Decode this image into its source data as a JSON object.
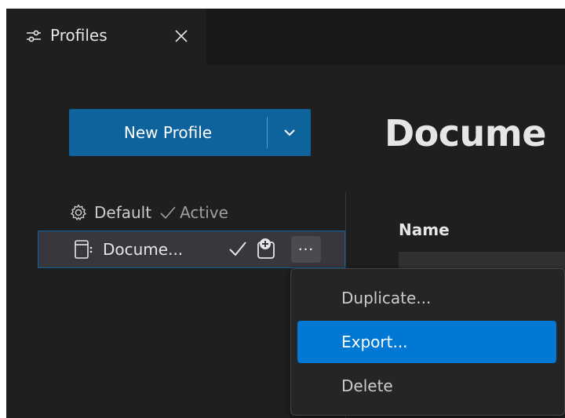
{
  "tab": {
    "label": "Profiles",
    "icon": "settings-sliders-icon",
    "close_icon": "close-icon"
  },
  "new_profile": {
    "label": "New Profile",
    "dropdown_icon": "chevron-down-icon"
  },
  "page_title": "Docume",
  "profiles": {
    "default": {
      "label": "Default",
      "status": "Active",
      "icon": "gear-icon"
    },
    "document": {
      "label": "Docume...",
      "icon": "document-profile-icon",
      "more_label": "···"
    }
  },
  "form": {
    "name_label": "Name"
  },
  "context_menu": {
    "items": [
      {
        "label": "Duplicate..."
      },
      {
        "label": "Export..."
      },
      {
        "label": "Delete"
      }
    ],
    "selected_index": 1
  },
  "colors": {
    "accent": "#0e639c",
    "selection": "#0078d4",
    "background": "#1f1f1f"
  }
}
